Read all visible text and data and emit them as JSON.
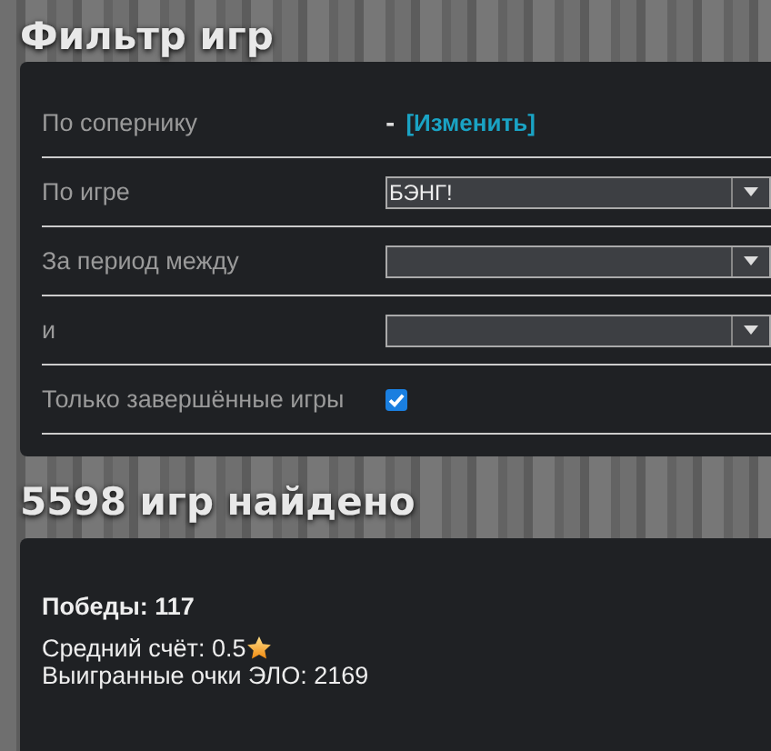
{
  "filter_title": "Фильтр игр",
  "filters": [
    {
      "kind": "opponent",
      "label": "По сопернику",
      "value": "-",
      "link": "[Изменить]"
    },
    {
      "kind": "select",
      "label": "По игре",
      "value": "БЭНГ!"
    },
    {
      "kind": "select",
      "label": "За период между"
    },
    {
      "kind": "select",
      "label": "и"
    },
    {
      "kind": "checkbox",
      "label": "Только завершённые игры",
      "checked": true
    }
  ],
  "results_title": "5598 игр найдено",
  "stats": {
    "wins": "Победы: 117",
    "average_score": "Средний счёт: 0.5",
    "elo": "Выигранные очки ЭЛО: 2169"
  }
}
